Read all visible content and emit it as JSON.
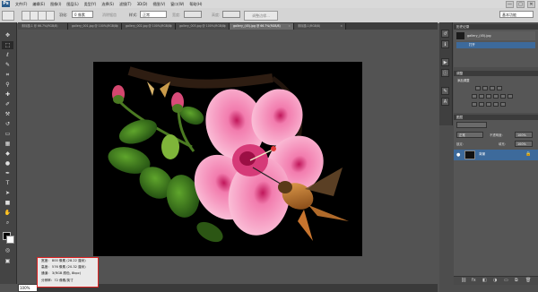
{
  "app": {
    "logo": "Ps"
  },
  "menu": {
    "items": [
      "文件(F)",
      "编辑(E)",
      "图像(I)",
      "图层(L)",
      "类型(Y)",
      "选择(S)",
      "滤镜(T)",
      "3D(D)",
      "视图(V)",
      "窗口(W)",
      "帮助(H)"
    ],
    "minimize": "—",
    "maximize": "□",
    "close": "✕"
  },
  "options": {
    "feather_label": "羽化:",
    "feather_value": "0 像素",
    "antialias_label": "消除锯齿",
    "style_label": "样式:",
    "style_value": "正常",
    "width_label": "宽度:",
    "height_label": "高度:",
    "refine_label": "调整边缘...",
    "workspace_value": "基本功能"
  },
  "tabs": [
    {
      "label": "未标题-1 @ 66.7%(RGB/8)",
      "close": "×"
    },
    {
      "label": "gallery_001.jpg @ 100%(RGB/8)",
      "close": "×"
    },
    {
      "label": "gallery_002.jpg @ 100%(RGB/8)",
      "close": "×"
    },
    {
      "label": "gallery_003.jpg @ 100%(RGB/8)",
      "close": "×"
    },
    {
      "label": "gallery_(45).jpg @ 66.7%(RGB/8)",
      "close": "×"
    },
    {
      "label": "未标题-1(RGB/8)",
      "close": "×"
    }
  ],
  "status": {
    "zoom": "100%"
  },
  "info": {
    "width": "宽度：  800 像素 (28.22 厘米)",
    "height": "高度：  576 像素 (20.32 厘米)",
    "channels": "通道：  3(RGB 颜色, 8bpc)",
    "resolution": "分辨率：72 像素/英寸"
  },
  "panels": {
    "history_tab": "历史记录",
    "history_state": "gallery_(45).jpg",
    "history_action": "打开",
    "adjust_tab": "调整",
    "adjust_title": "添加调整",
    "layers_tab": "图层",
    "blend_mode": "正常",
    "opacity_label": "不透明度:",
    "opacity_value": "100%",
    "lock_label": "锁定:",
    "fill_label": "填充:",
    "fill_value": "100%",
    "layer_name": "背景"
  },
  "colors": {
    "accent": "#2b5c8c",
    "canvas_bg": "#000000",
    "infobox_border": "#dd2222",
    "app_bg": "#535353"
  }
}
